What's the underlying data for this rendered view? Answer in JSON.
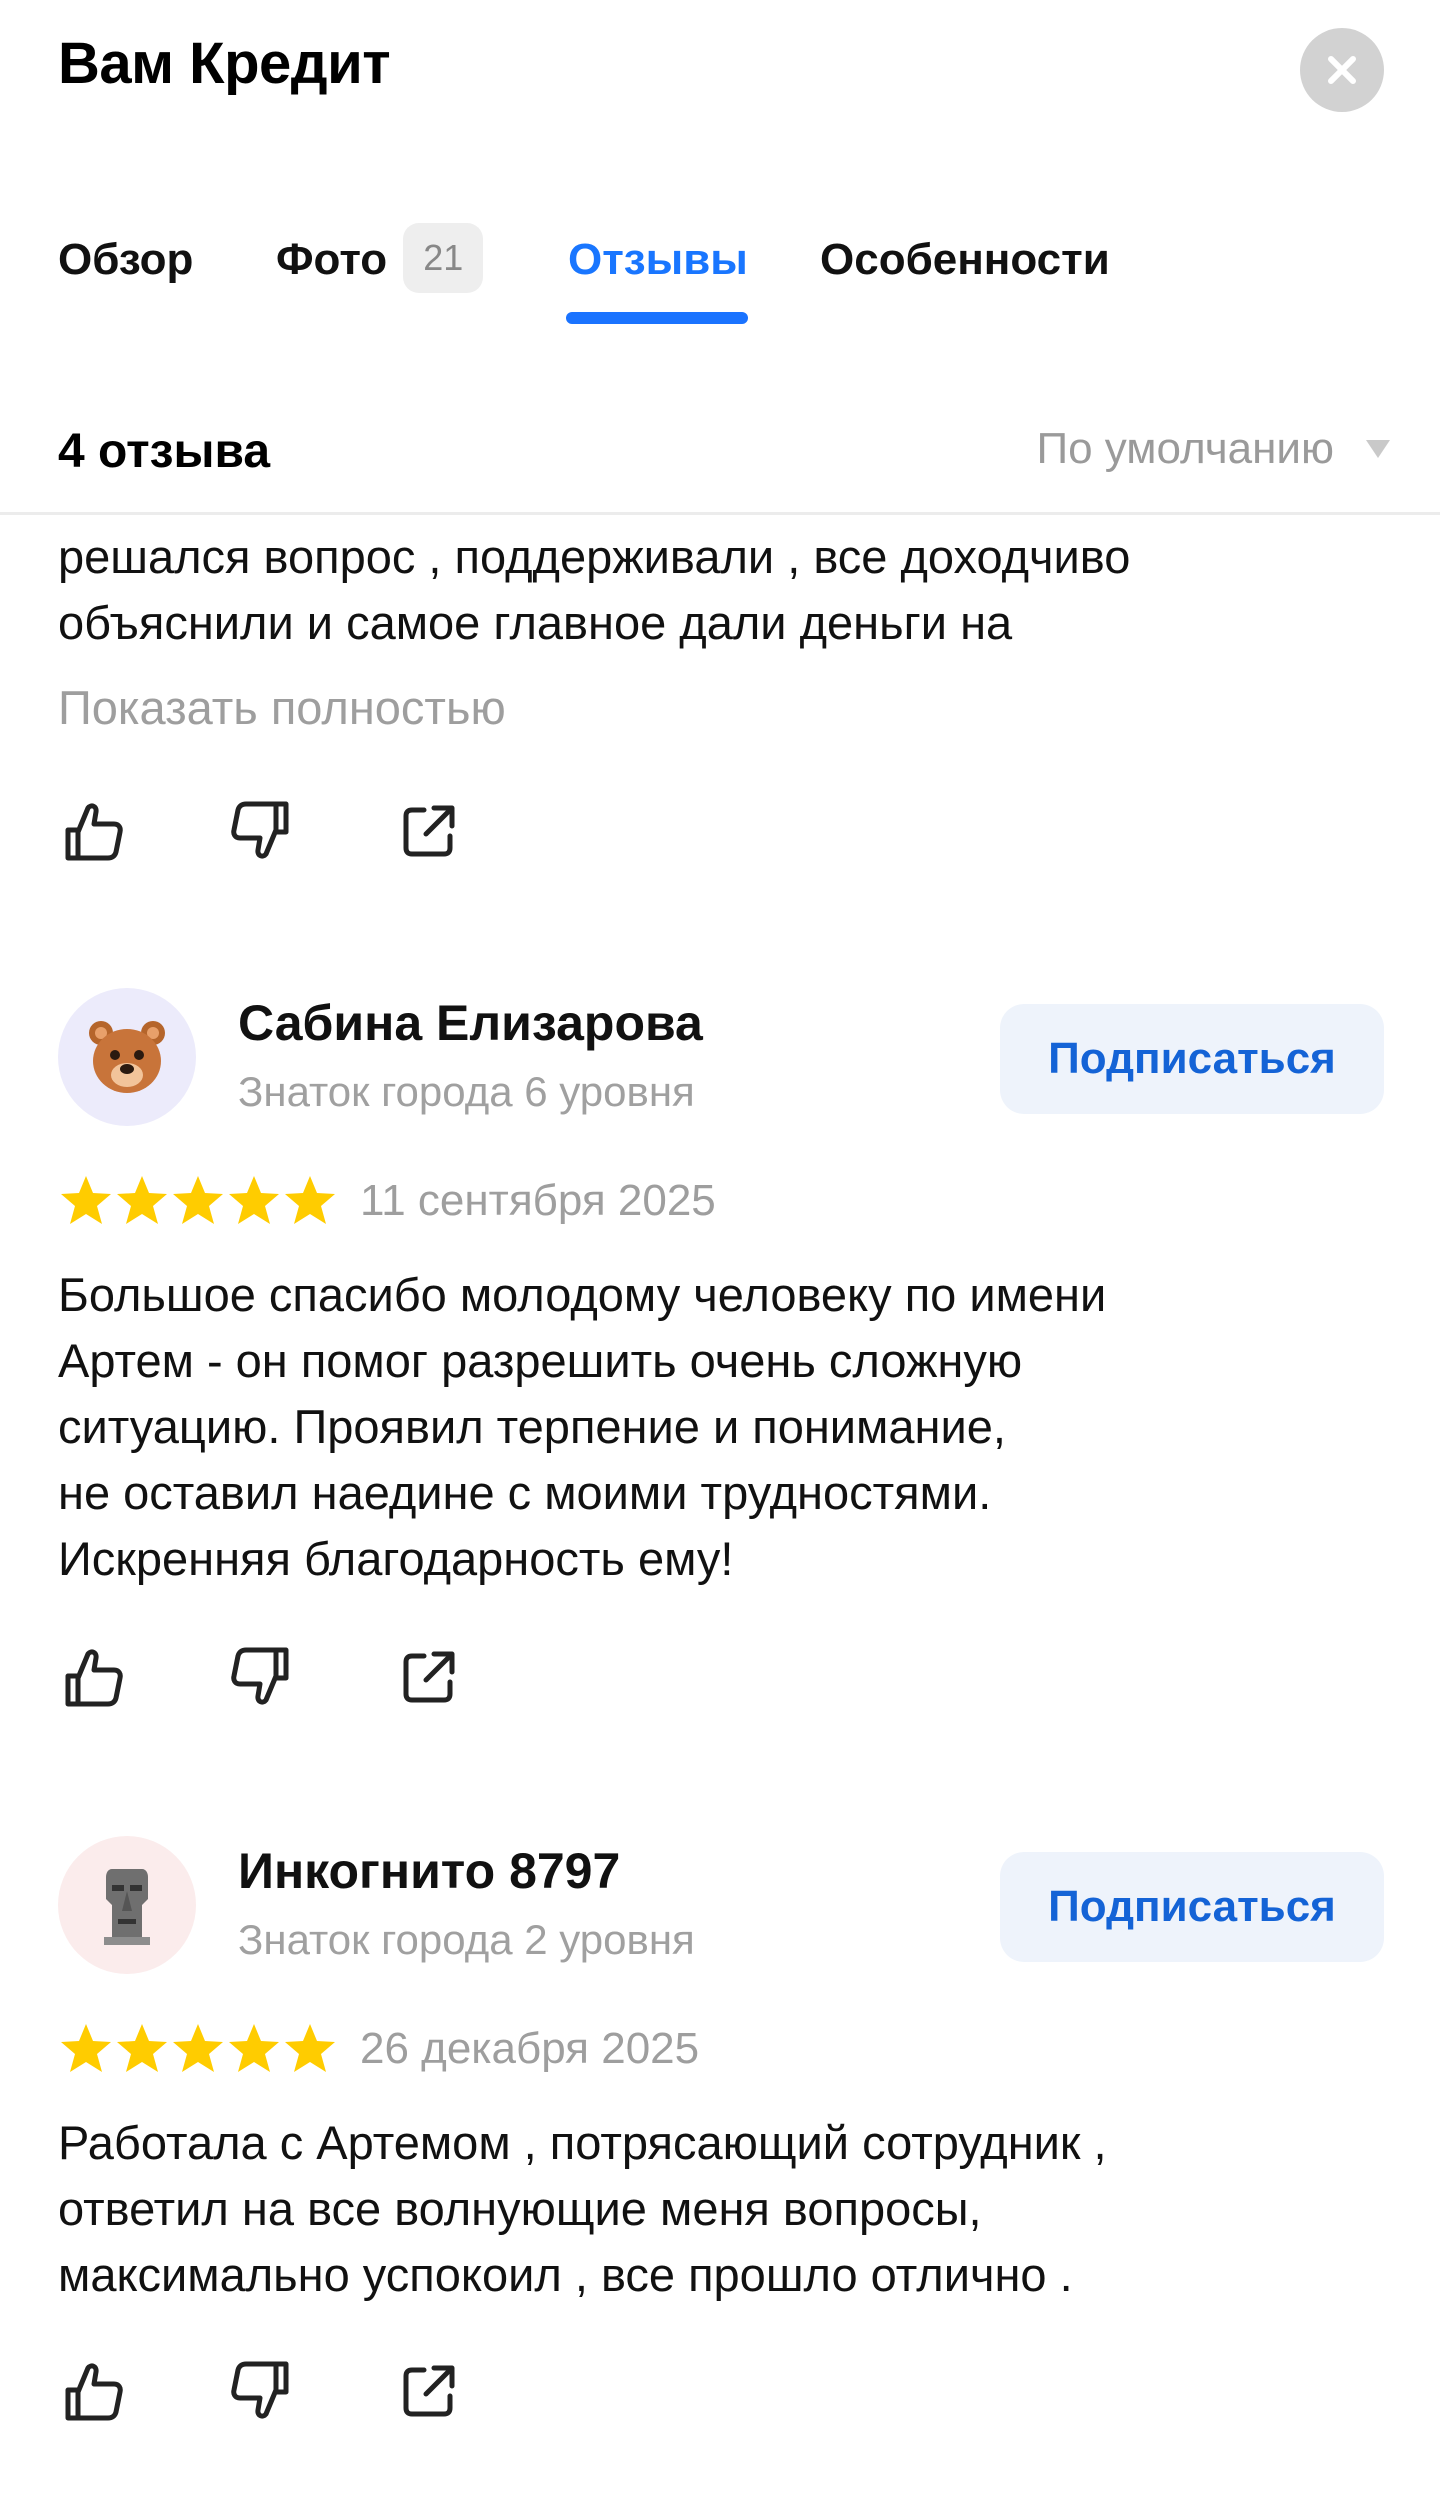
{
  "header": {
    "title": "Вам Кредит",
    "close_icon": "close-icon"
  },
  "tabs": [
    {
      "label": "Обзор",
      "active": false
    },
    {
      "label": "Фото",
      "badge": "21",
      "active": false
    },
    {
      "label": "Отзывы",
      "active": true
    },
    {
      "label": "Особенности",
      "active": false
    }
  ],
  "reviews_header": {
    "count_label": "4 отзыва",
    "sort_label": "По умолчанию"
  },
  "colors": {
    "accent": "#1a73ff",
    "star": "#ffcc00",
    "muted": "#9e9e9e",
    "subscribe_bg": "#eef3fb",
    "subscribe_text": "#1463d6"
  },
  "reviews": [
    {
      "text": "решался вопрос , поддерживали , все доходчиво\nобъяснили и самое главное дали деньги на",
      "show_more": "Показать полностью",
      "actions": [
        "thumbs-up-icon",
        "thumbs-down-icon",
        "share-icon"
      ]
    },
    {
      "author": "Сабина Елизарова",
      "level": "Знаток города 6 уровня",
      "avatar_icon": "bear-icon",
      "subscribe_label": "Подписаться",
      "rating": 5,
      "date": "11 сентября 2025",
      "text": "Большое спасибо молодому человеку по имени\nАртем - он помог разрешить  очень сложную\nситуацию.  Проявил терпение и понимание,\nне оставил наедине с моими трудностями.\nИскренняя благодарность ему!",
      "actions": [
        "thumbs-up-icon",
        "thumbs-down-icon",
        "share-icon"
      ]
    },
    {
      "author": "Инкогнито 8797",
      "level": "Знаток города 2 уровня",
      "avatar_icon": "moai-icon",
      "subscribe_label": "Подписаться",
      "rating": 5,
      "date": "26 декабря 2025",
      "text": "Работала с Артемом ,  потрясающий сотрудник ,\nответил на все волнующие меня вопросы,\nмаксимально успокоил , все прошло отлично .",
      "actions": [
        "thumbs-up-icon",
        "thumbs-down-icon",
        "share-icon"
      ]
    }
  ]
}
